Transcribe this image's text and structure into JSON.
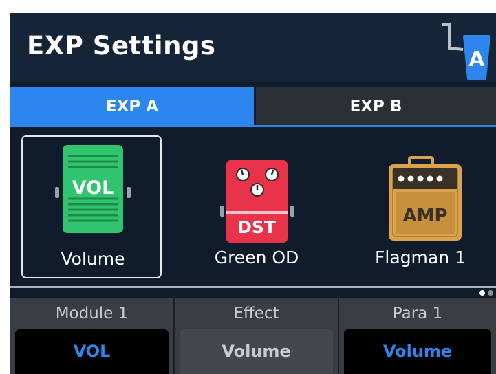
{
  "header": {
    "title": "EXP Settings",
    "indicator_letter": "A",
    "indicator_icon": "expression-pedal-icon"
  },
  "tabs": [
    {
      "label": "EXP A",
      "active": true
    },
    {
      "label": "EXP B",
      "active": false
    }
  ],
  "effects": [
    {
      "label": "Volume",
      "icon": "vol-pedal-icon",
      "icon_text": "VOL",
      "selected": true
    },
    {
      "label": "Green OD",
      "icon": "dst-pedal-icon",
      "icon_text": "DST",
      "selected": false
    },
    {
      "label": "Flagman 1",
      "icon": "amp-icon",
      "icon_text": "AMP",
      "selected": false
    }
  ],
  "pagination": {
    "current_page": 1,
    "total_pages": 2
  },
  "params": [
    {
      "label": "Module 1",
      "value": "VOL"
    },
    {
      "label": "Effect",
      "value": "Volume"
    },
    {
      "label": "Para 1",
      "value": "Volume"
    }
  ],
  "colors": {
    "accent": "#2c86ee",
    "background": "#101b2b",
    "vol_green": "#2fc46d",
    "dst_red": "#e8334a",
    "amp_tan": "#d9a24c",
    "effect_value_box": "#44474d"
  }
}
